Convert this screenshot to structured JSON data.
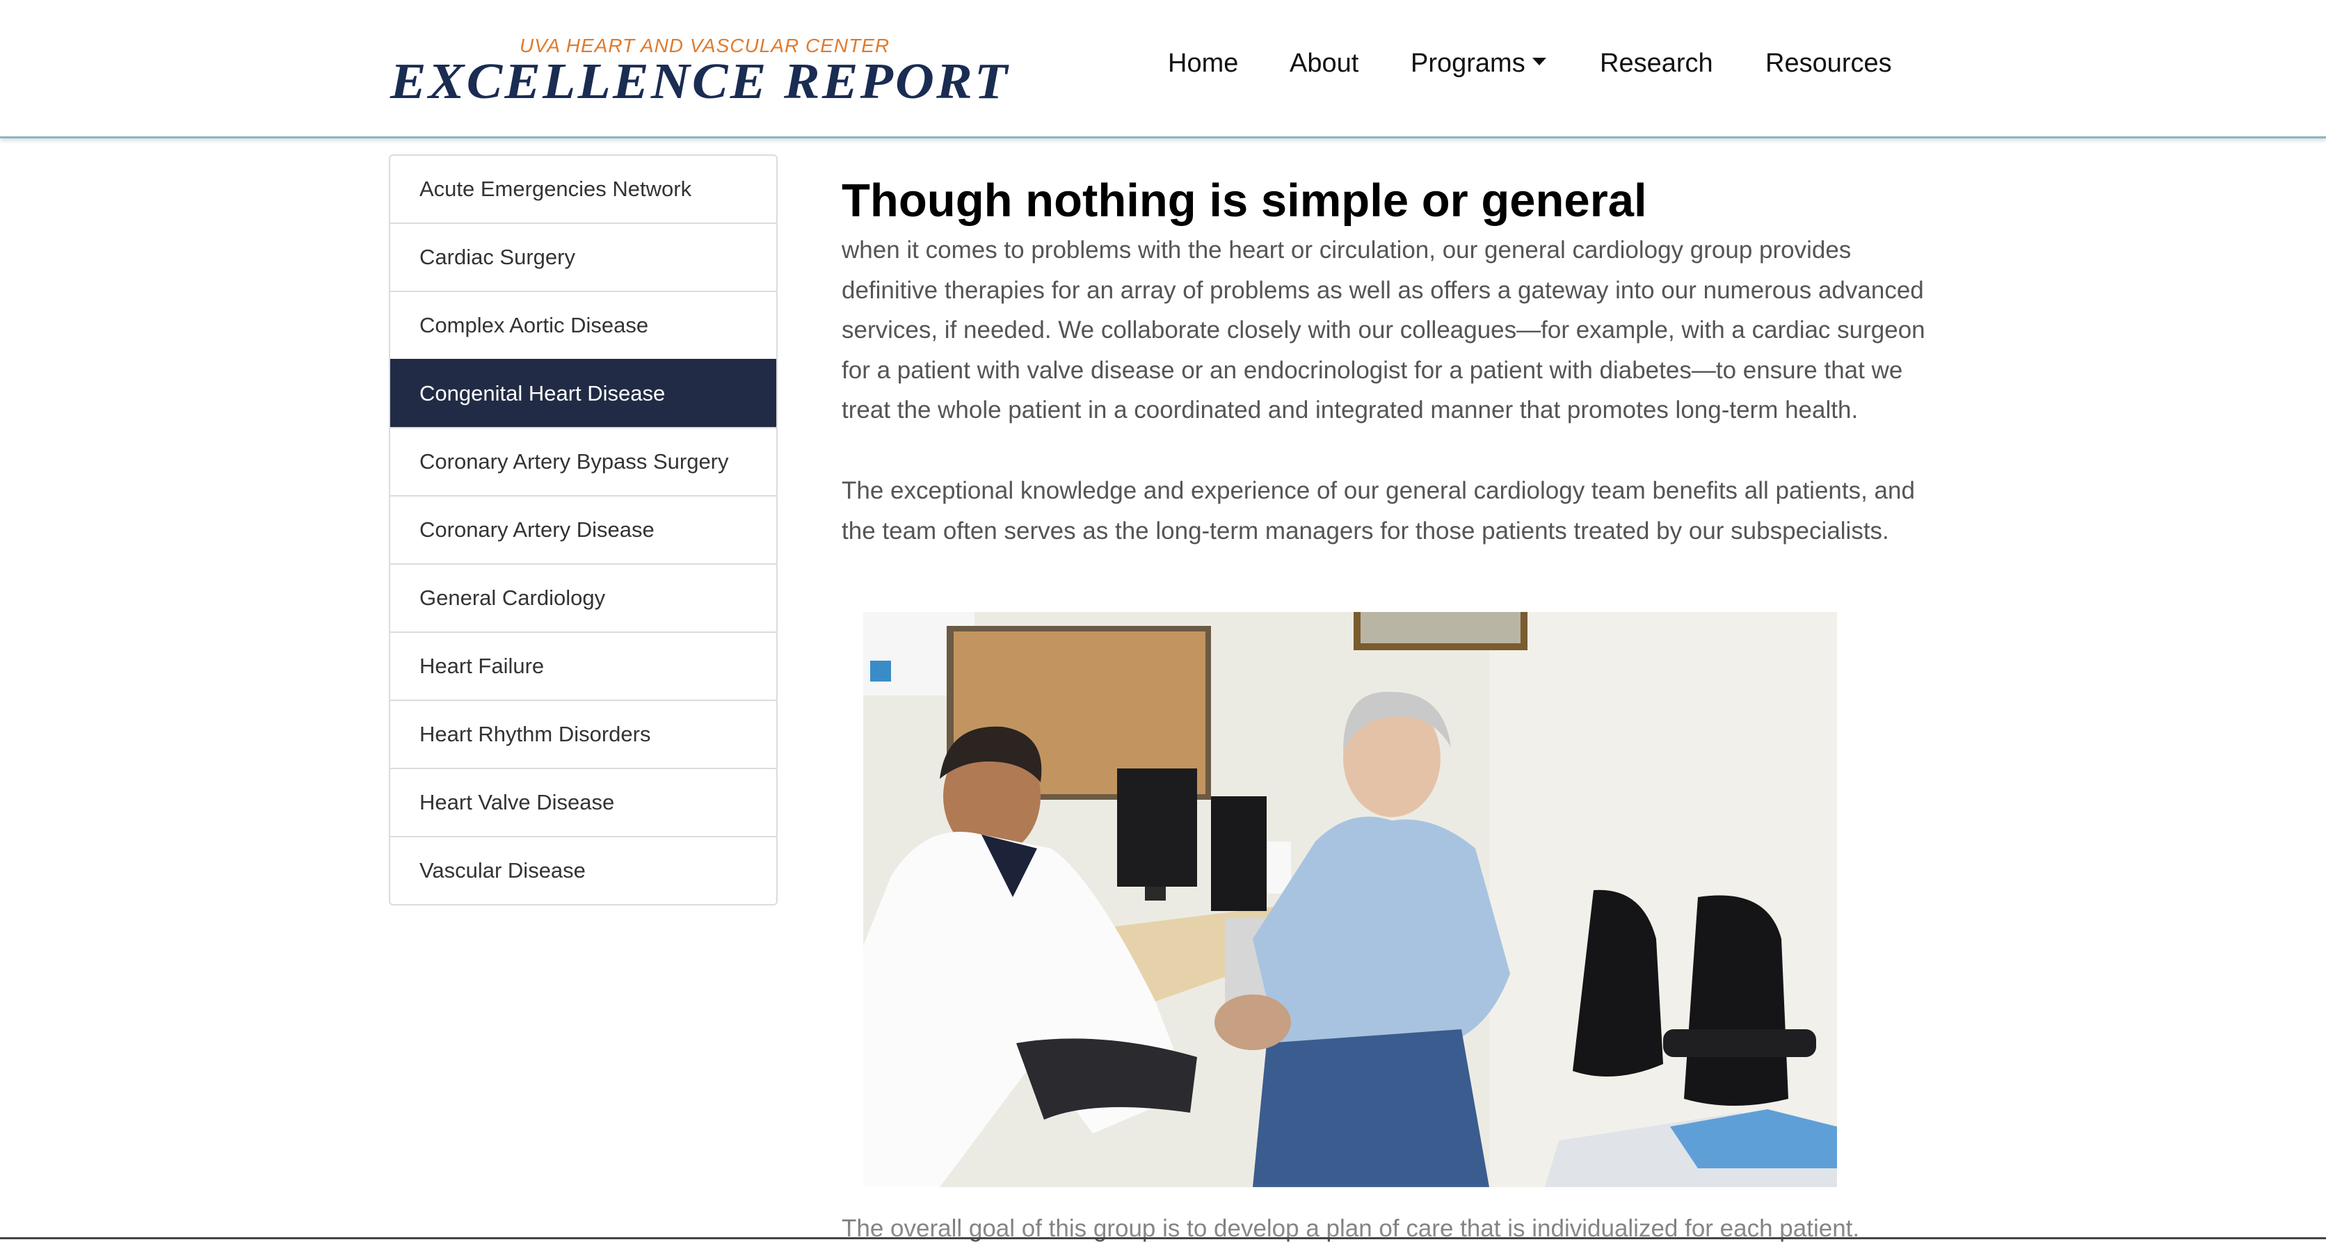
{
  "header": {
    "brand_sub": "UVA HEART AND VASCULAR CENTER",
    "brand_main": "EXCELLENCE REPORT",
    "brand_colors": {
      "sub": "#e07a2c",
      "main": "#1a2c52"
    },
    "nav": {
      "home": "Home",
      "about": "About",
      "programs": "Programs",
      "research": "Research",
      "resources": "Resources"
    }
  },
  "sidebar": {
    "active_color": "#222b45",
    "items": [
      {
        "label": "Acute Emergencies Network"
      },
      {
        "label": "Cardiac Surgery"
      },
      {
        "label": "Complex Aortic Disease"
      },
      {
        "label": "Congenital Heart Disease",
        "active": true
      },
      {
        "label": "Coronary Artery Bypass Surgery"
      },
      {
        "label": "Coronary Artery Disease"
      },
      {
        "label": "General Cardiology"
      },
      {
        "label": "Heart Failure"
      },
      {
        "label": "Heart Rhythm Disorders"
      },
      {
        "label": "Heart Valve Disease"
      },
      {
        "label": "Vascular Disease"
      }
    ]
  },
  "main": {
    "title": "Though nothing is simple or general",
    "paragraphs": [
      "when it comes to problems with the heart or circulation, our general cardiology group provides definitive therapies for an array of problems as well as offers a gateway into our numerous advanced services, if needed. We collaborate closely with our colleagues—for example, with a cardiac surgeon for a patient with valve disease or an endocrinologist for a patient with diabetes—to ensure that we treat the whole patient in a coordinated and integrated manner that promotes long-term health.",
      "The exceptional knowledge and experience of our general cardiology team benefits all patients, and the team often serves as the long-term managers for those patients treated by our subspecialists.",
      "The overall goal of this group is to develop a plan of care that is individualized for each patient."
    ]
  }
}
